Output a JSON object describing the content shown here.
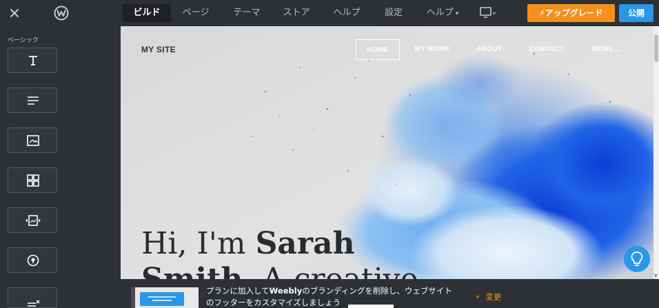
{
  "topbar": {
    "close_icon": "close-icon",
    "logo_icon": "weebly-logo",
    "tabs": [
      {
        "label": "ビルド",
        "active": true
      },
      {
        "label": "ページ"
      },
      {
        "label": "テーマ"
      },
      {
        "label": "ストア"
      },
      {
        "label": "ヘルプ"
      },
      {
        "label": "設定"
      },
      {
        "label": "ヘルプ",
        "has_caret": true
      }
    ],
    "device_icon": "desktop-icon",
    "upgrade_label": "アップグレード",
    "publish_label": "公開"
  },
  "sidebar": {
    "section_label": "ベーシック",
    "items": [
      {
        "icon": "title-icon"
      },
      {
        "icon": "text-icon"
      },
      {
        "icon": "image-icon"
      },
      {
        "icon": "gallery-icon"
      },
      {
        "icon": "slideshow-icon"
      },
      {
        "icon": "map-icon"
      },
      {
        "icon": "form-icon"
      }
    ]
  },
  "site": {
    "name": "MY SITE",
    "nav": [
      {
        "label": "HOME",
        "active": true
      },
      {
        "label": "MY WORK"
      },
      {
        "label": "ABOUT"
      },
      {
        "label": "CONTACT"
      },
      {
        "label": "MORE..."
      }
    ],
    "headline_line1_regular": "Hi, I'm ",
    "headline_line1_bold": "Sarah",
    "headline_line2_bold": "Smith",
    "headline_line2_regular": ". A creative",
    "help_icon": "lightbulb-icon"
  },
  "footer_bar": {
    "message_line1_a": "プランに加入して",
    "message_brand": "Weebly",
    "message_line1_b": "のブランディングを削除し、ウェブサイト",
    "message_line2": "のフッターをカスタマイズしましょう",
    "change_label": "変更"
  },
  "colors": {
    "upgrade": "#f3901c",
    "publish": "#2a96e8",
    "chrome": "#2d3034"
  }
}
